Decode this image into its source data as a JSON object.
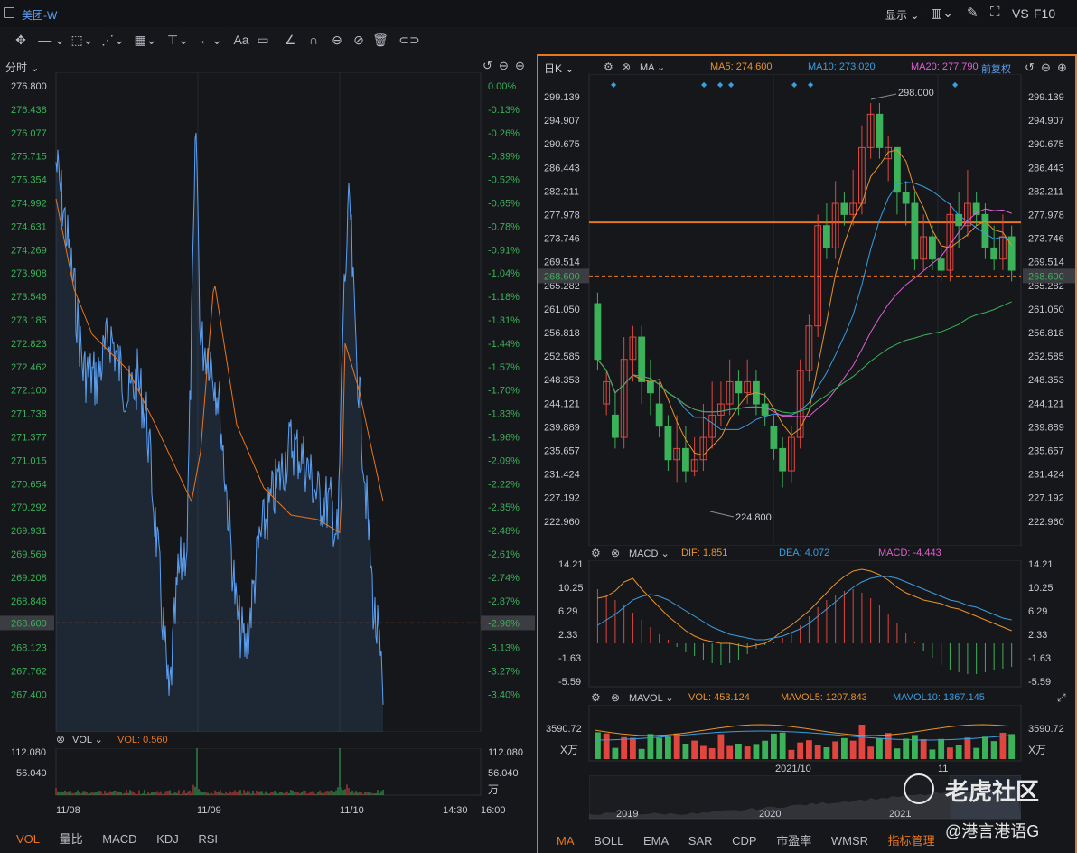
{
  "window": {
    "title": "美团-W",
    "display_label": "显示",
    "vs_label": "VS",
    "f10_label": "F10"
  },
  "intraday": {
    "tab": "分时",
    "price_ticks": [
      "276.800",
      "276.438",
      "276.077",
      "275.715",
      "275.354",
      "274.992",
      "274.631",
      "274.269",
      "273.908",
      "273.546",
      "273.185",
      "272.823",
      "272.462",
      "272.100",
      "271.738",
      "271.377",
      "271.015",
      "270.654",
      "270.292",
      "269.931",
      "269.569",
      "269.208",
      "268.846",
      "268.485",
      "268.123",
      "267.762",
      "267.400"
    ],
    "pct_ticks": [
      "0.00%",
      "-0.13%",
      "-0.26%",
      "-0.39%",
      "-0.52%",
      "-0.65%",
      "-0.78%",
      "-0.91%",
      "-1.04%",
      "-1.18%",
      "-1.31%",
      "-1.44%",
      "-1.57%",
      "-1.70%",
      "-1.83%",
      "-1.96%",
      "-2.09%",
      "-2.22%",
      "-2.35%",
      "-2.48%",
      "-2.61%",
      "-2.74%",
      "-2.87%",
      "-2.96%",
      "-3.13%",
      "-3.27%",
      "-3.40%"
    ],
    "current_price": "268.600",
    "current_pct": "-2.96%",
    "vol_label": "VOL",
    "vol_value": "VOL: 0.560",
    "vol_ticks": [
      "112.080",
      "56.040",
      "万"
    ],
    "x_ticks": [
      "11/08",
      "11/09",
      "11/10",
      "14:30",
      "16:00"
    ],
    "bottom_tabs": [
      "VOL",
      "量比",
      "MACD",
      "KDJ",
      "RSI"
    ],
    "colors": {
      "price_line": "#5ba0f2",
      "avg_line": "#e8761f",
      "up": "#e0463f",
      "down": "#3bb159"
    }
  },
  "kline": {
    "period": "日K",
    "indicator": "MA",
    "ma5": "MA5: 274.600",
    "ma10": "MA10: 273.020",
    "ma20": "MA20: 277.790",
    "adjust": "前复权",
    "price_ticks": [
      "299.139",
      "294.907",
      "290.675",
      "286.443",
      "282.211",
      "277.978",
      "273.746",
      "269.514",
      "265.282",
      "261.050",
      "256.818",
      "252.585",
      "248.353",
      "244.121",
      "239.889",
      "235.657",
      "231.424",
      "227.192",
      "222.960"
    ],
    "current_price": "268.600",
    "high_label": "298.000",
    "low_label": "224.800",
    "macd": {
      "title": "MACD",
      "dif": "DIF: 1.851",
      "dea": "DEA: 4.072",
      "macd": "MACD: -4.443",
      "ticks": [
        "14.21",
        "10.25",
        "6.29",
        "2.33",
        "-1.63",
        "-5.59"
      ]
    },
    "mavol": {
      "title": "MAVOL",
      "vol": "VOL: 453.124",
      "mavol5": "MAVOL5: 1207.843",
      "mavol10": "MAVOL10: 1367.145",
      "ticks": [
        "3590.72",
        "X万"
      ]
    },
    "x_ticks": [
      "2021/10",
      "11"
    ],
    "overview_years": [
      "2019",
      "2020",
      "2021"
    ],
    "bottom_tabs": [
      "MA",
      "BOLL",
      "EMA",
      "SAR",
      "CDP",
      "市盈率",
      "WMSR",
      "指标管理"
    ],
    "colors": {
      "ma5": "#e8932b",
      "ma10": "#3a9ee0",
      "ma20": "#e05fd1",
      "ma60": "#3bb159",
      "up": "#e0463f",
      "down": "#3bb159",
      "orange": "#e8761f"
    }
  },
  "watermark": {
    "brand": "老虎社区",
    "author": "@港言港语G"
  }
}
